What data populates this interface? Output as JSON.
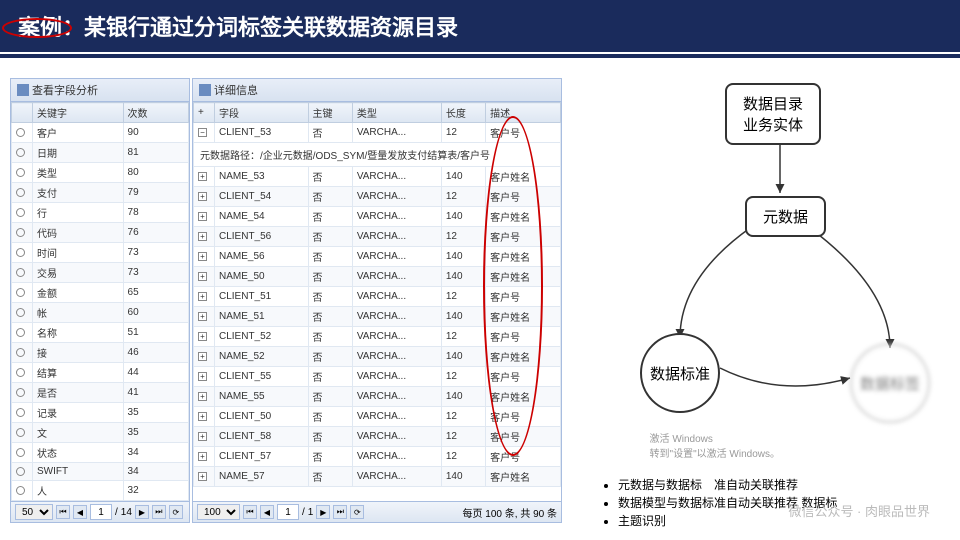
{
  "title": "案例：某银行通过分词标签关联数据资源目录",
  "left_panel": {
    "header": "查看字段分析",
    "columns": [
      "关键字",
      "次数"
    ],
    "rows": [
      {
        "kw": "客户",
        "count": 90,
        "circled": true
      },
      {
        "kw": "日期",
        "count": 81
      },
      {
        "kw": "类型",
        "count": 80
      },
      {
        "kw": "支付",
        "count": 79
      },
      {
        "kw": "行",
        "count": 78
      },
      {
        "kw": "代码",
        "count": 76
      },
      {
        "kw": "时间",
        "count": 73
      },
      {
        "kw": "交易",
        "count": 73
      },
      {
        "kw": "金额",
        "count": 65
      },
      {
        "kw": "帐",
        "count": 60
      },
      {
        "kw": "名称",
        "count": 51
      },
      {
        "kw": "接",
        "count": 46
      },
      {
        "kw": "结算",
        "count": 44
      },
      {
        "kw": "是否",
        "count": 41
      },
      {
        "kw": "记录",
        "count": 35
      },
      {
        "kw": "文",
        "count": 35
      },
      {
        "kw": "状态",
        "count": 34
      },
      {
        "kw": "SWIFT",
        "count": 34
      },
      {
        "kw": "人",
        "count": 32
      }
    ],
    "pager": {
      "size": "50",
      "page": "1",
      "total": "14"
    }
  },
  "right_panel": {
    "header": "详细信息",
    "columns": [
      "+",
      "字段",
      "主键",
      "类型",
      "长度",
      "描述"
    ],
    "meta_path": "元数据路径：/企业元数据/ODS_SYM/暨量发放支付结算表/客户号",
    "rows": [
      {
        "f": "CLIENT_53",
        "pk": "否",
        "t": "VARCHA...",
        "len": "12",
        "d": "客户号",
        "top": true
      },
      {
        "f": "NAME_53",
        "pk": "否",
        "t": "VARCHA...",
        "len": "140",
        "d": "客户姓名"
      },
      {
        "f": "CLIENT_54",
        "pk": "否",
        "t": "VARCHA...",
        "len": "12",
        "d": "客户号"
      },
      {
        "f": "NAME_54",
        "pk": "否",
        "t": "VARCHA...",
        "len": "140",
        "d": "客户姓名"
      },
      {
        "f": "CLIENT_56",
        "pk": "否",
        "t": "VARCHA...",
        "len": "12",
        "d": "客户号"
      },
      {
        "f": "NAME_56",
        "pk": "否",
        "t": "VARCHA...",
        "len": "140",
        "d": "客户姓名"
      },
      {
        "f": "NAME_50",
        "pk": "否",
        "t": "VARCHA...",
        "len": "140",
        "d": "客户姓名"
      },
      {
        "f": "CLIENT_51",
        "pk": "否",
        "t": "VARCHA...",
        "len": "12",
        "d": "客户号"
      },
      {
        "f": "NAME_51",
        "pk": "否",
        "t": "VARCHA...",
        "len": "140",
        "d": "客户姓名"
      },
      {
        "f": "CLIENT_52",
        "pk": "否",
        "t": "VARCHA...",
        "len": "12",
        "d": "客户号"
      },
      {
        "f": "NAME_52",
        "pk": "否",
        "t": "VARCHA...",
        "len": "140",
        "d": "客户姓名"
      },
      {
        "f": "CLIENT_55",
        "pk": "否",
        "t": "VARCHA...",
        "len": "12",
        "d": "客户号"
      },
      {
        "f": "NAME_55",
        "pk": "否",
        "t": "VARCHA...",
        "len": "140",
        "d": "客户姓名"
      },
      {
        "f": "CLIENT_50",
        "pk": "否",
        "t": "VARCHA...",
        "len": "12",
        "d": "客户号"
      },
      {
        "f": "CLIENT_58",
        "pk": "否",
        "t": "VARCHA...",
        "len": "12",
        "d": "客户号"
      },
      {
        "f": "CLIENT_57",
        "pk": "否",
        "t": "VARCHA...",
        "len": "12",
        "d": "客户号"
      },
      {
        "f": "NAME_57",
        "pk": "否",
        "t": "VARCHA...",
        "len": "140",
        "d": "客户姓名"
      }
    ],
    "pager": {
      "size": "100",
      "page": "1",
      "total": "1",
      "info": "每页 100 条, 共 90 条"
    }
  },
  "diagram": {
    "node1": "数据目录\n业务实体",
    "node2": "元数据",
    "node3": "数据标准",
    "node4": "数据标签"
  },
  "bullets": [
    "元数据与数据标　准自动关联推荐",
    "数据模型与数据标准自动关联推荐 数据标",
    "主题识别"
  ],
  "watermark": "激活 Windows\n转到\"设置\"以激活 Windows。",
  "wechat": "微信公众号 · 肉眼品世界"
}
